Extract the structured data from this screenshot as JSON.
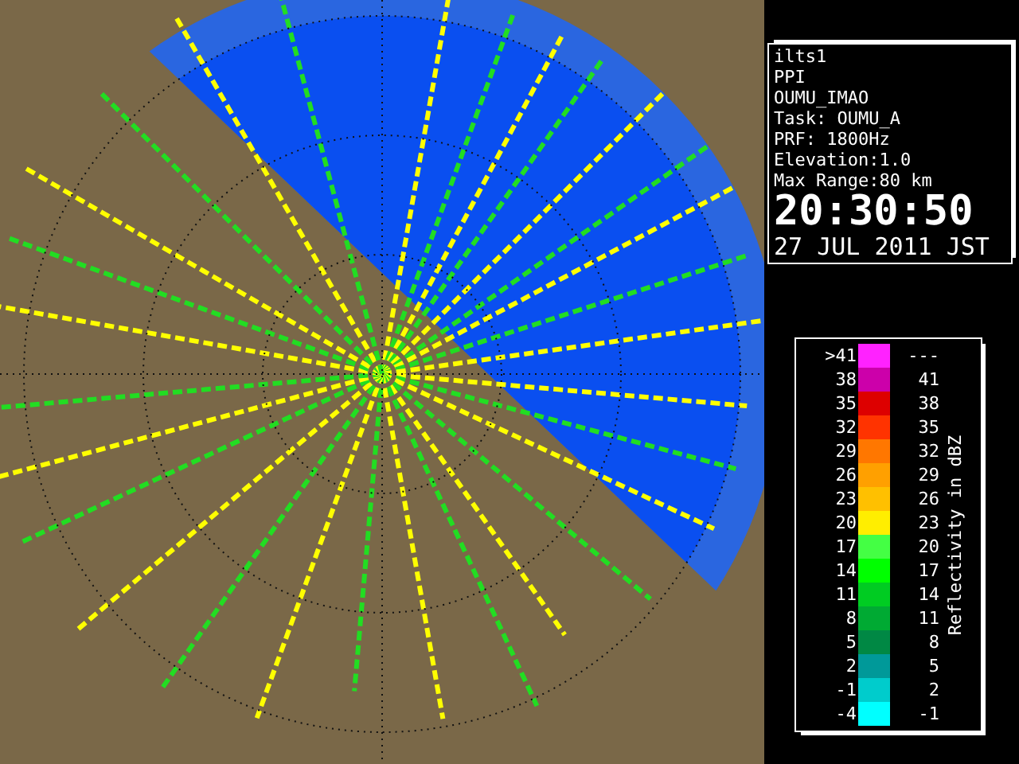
{
  "info": {
    "lines": [
      "ilts1",
      "PPI",
      "OUMU_IMAO",
      "Task: OUMU_A",
      "PRF: 1800Hz",
      "Elevation:1.0",
      "Max Range:80 km"
    ],
    "time": "20:30:50",
    "date": "27 JUL 2011 JST"
  },
  "legend": {
    "title": "Reflectivity in dBZ",
    "rows": [
      {
        "low": ">41",
        "high": "---",
        "color": "#ff22ff"
      },
      {
        "low": "38",
        "high": "41",
        "color": "#cc00aa"
      },
      {
        "low": "35",
        "high": "38",
        "color": "#dd0000"
      },
      {
        "low": "32",
        "high": "35",
        "color": "#ff3300"
      },
      {
        "low": "29",
        "high": "32",
        "color": "#ff7700"
      },
      {
        "low": "26",
        "high": "29",
        "color": "#ffa000"
      },
      {
        "low": "23",
        "high": "26",
        "color": "#ffc000"
      },
      {
        "low": "20",
        "high": "23",
        "color": "#ffee00"
      },
      {
        "low": "17",
        "high": "20",
        "color": "#44ff44"
      },
      {
        "low": "14",
        "high": "17",
        "color": "#00ff00"
      },
      {
        "low": "11",
        "high": "14",
        "color": "#00cc22"
      },
      {
        "low": "8",
        "high": "11",
        "color": "#00aa33"
      },
      {
        "low": "5",
        "high": "8",
        "color": "#008844"
      },
      {
        "low": "2",
        "high": "5",
        "color": "#009999"
      },
      {
        "low": "-1",
        "high": "2",
        "color": "#00cccc"
      },
      {
        "low": "-4",
        "high": "-1",
        "color": "#00ffff"
      }
    ]
  }
}
